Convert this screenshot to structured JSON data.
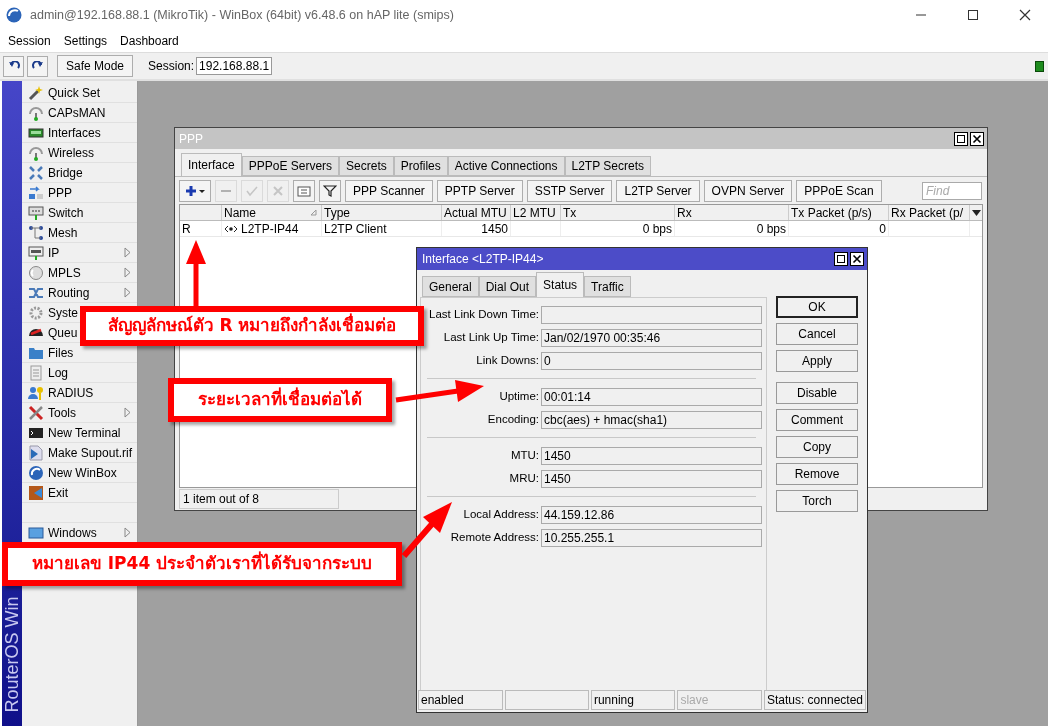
{
  "window": {
    "title": "admin@192.168.88.1 (MikroTik) - WinBox (64bit) v6.48.6 on hAP lite (smips)"
  },
  "menu": [
    "Session",
    "Settings",
    "Dashboard"
  ],
  "toolbar": {
    "safe_mode": "Safe Mode",
    "session_label": "Session:",
    "session_value": "192.168.88.1"
  },
  "sidebar": {
    "brand": "RouterOS Win",
    "items": [
      {
        "label": "Quick Set",
        "submenu": false
      },
      {
        "label": "CAPsMAN",
        "submenu": false
      },
      {
        "label": "Interfaces",
        "submenu": false
      },
      {
        "label": "Wireless",
        "submenu": false
      },
      {
        "label": "Bridge",
        "submenu": false
      },
      {
        "label": "PPP",
        "submenu": false
      },
      {
        "label": "Switch",
        "submenu": false
      },
      {
        "label": "Mesh",
        "submenu": false
      },
      {
        "label": "IP",
        "submenu": true
      },
      {
        "label": "MPLS",
        "submenu": true
      },
      {
        "label": "Routing",
        "submenu": true
      },
      {
        "label": "Syste"
      },
      {
        "label": "Queu"
      },
      {
        "label": "Files",
        "submenu": false
      },
      {
        "label": "Log",
        "submenu": false
      },
      {
        "label": "RADIUS",
        "submenu": false
      },
      {
        "label": "Tools",
        "submenu": true
      },
      {
        "label": "New Terminal",
        "submenu": false
      },
      {
        "label": "Make Supout.rif",
        "submenu": false
      },
      {
        "label": "New WinBox",
        "submenu": false
      },
      {
        "label": "Exit",
        "submenu": false
      }
    ],
    "bottom_items": [
      {
        "label": "Windows",
        "submenu": true
      }
    ]
  },
  "ppp_window": {
    "title": "PPP",
    "tabs": [
      {
        "label": "Interface",
        "selected": true
      },
      {
        "label": "PPPoE Servers",
        "selected": false
      },
      {
        "label": "Secrets",
        "selected": false
      },
      {
        "label": "Profiles",
        "selected": false
      },
      {
        "label": "Active Connections",
        "selected": false
      },
      {
        "label": "L2TP Secrets",
        "selected": false
      }
    ],
    "icon_buttons": [
      {
        "kind": "add",
        "disabled": false
      },
      {
        "kind": "remove",
        "disabled": true
      },
      {
        "kind": "enable",
        "disabled": true
      },
      {
        "kind": "disable",
        "disabled": true
      },
      {
        "kind": "comment",
        "disabled": false
      },
      {
        "kind": "filter",
        "disabled": false
      }
    ],
    "buttons": [
      "PPP Scanner",
      "PPTP Server",
      "SSTP Server",
      "L2TP Server",
      "OVPN Server",
      "PPPoE Scan"
    ],
    "search": {
      "placeholder": "Find"
    },
    "table": {
      "columns": [
        "Name",
        "Type",
        "Actual MTU",
        "L2 MTU",
        "Tx",
        "Rx",
        "Tx Packet (p/s)",
        "Rx Packet (p/"
      ],
      "rows": [
        {
          "flag": "R",
          "name": "L2TP-IP44",
          "type": "L2TP Client",
          "actual_mtu": "1450",
          "tx": "0 bps",
          "rx": "0 bps",
          "tx_packet": "0"
        }
      ]
    },
    "status": "1 item out of 8"
  },
  "interface_dialog": {
    "title": "Interface <L2TP-IP44>",
    "tabs": [
      {
        "label": "General",
        "selected": false
      },
      {
        "label": "Dial Out",
        "selected": false
      },
      {
        "label": "Status",
        "selected": true
      },
      {
        "label": "Traffic",
        "selected": false
      }
    ],
    "groups": [
      [
        {
          "label": "Last Link Down Time:"
        },
        {
          "label": "Last Link Up Time:",
          "value": "Jan/02/1970 00:35:46"
        },
        {
          "label": "Link Downs:",
          "value": "0"
        }
      ],
      [
        {
          "label": "Uptime:",
          "value": "00:01:14"
        },
        {
          "label": "Encoding:",
          "value": "cbc(aes) + hmac(sha1)"
        }
      ],
      [
        {
          "label": "MTU:",
          "value": "1450"
        },
        {
          "label": "MRU:",
          "value": "1450"
        }
      ],
      [
        {
          "label": "Local Address:",
          "value": "44.159.12.86"
        },
        {
          "label": "Remote Address:",
          "value": "10.255.255.1"
        }
      ]
    ],
    "button_groups": [
      [
        {
          "label": "OK",
          "default": true
        },
        {
          "label": "Cancel",
          "default": false
        },
        {
          "label": "Apply",
          "default": false
        }
      ],
      [
        {
          "label": "Disable",
          "default": false
        },
        {
          "label": "Comment",
          "default": false
        },
        {
          "label": "Copy",
          "default": false
        },
        {
          "label": "Remove",
          "default": false
        },
        {
          "label": "Torch",
          "default": false
        }
      ]
    ],
    "status_bar": [
      {
        "text": "enabled",
        "disabled": false
      },
      {
        "text": "running",
        "disabled": false
      },
      {
        "text": "slave",
        "disabled": true
      },
      {
        "text": "Status: connected",
        "disabled": false
      }
    ]
  },
  "annotations": [
    {
      "text": "สัญญลักษณ์ตัว R หมายถึงกำลังเชื่อมต่อ"
    },
    {
      "text": "ระยะเวลาที่เชื่อมต่อได้"
    },
    {
      "text": "หมายเลข IP44 ประจำตัวเราที่ได้รับจากระบบ"
    }
  ]
}
